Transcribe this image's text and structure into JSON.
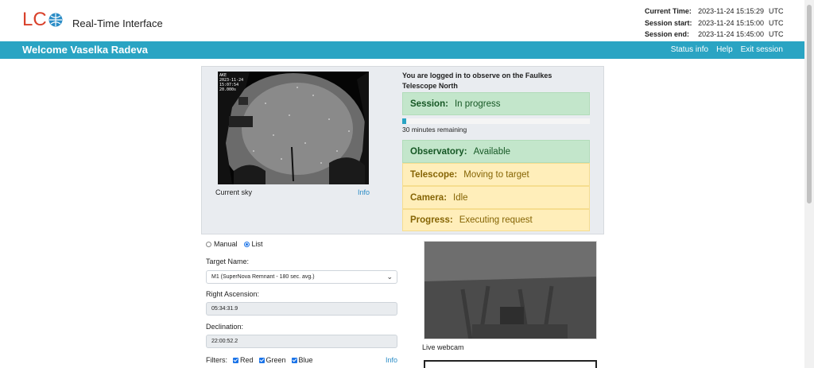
{
  "header": {
    "logo_text": "LC",
    "app_title": "Real-Time Interface",
    "current_time_label": "Current Time:",
    "current_time": "2023-11-24 15:15:29",
    "session_start_label": "Session start:",
    "session_start": "2023-11-24 15:15:00",
    "session_end_label": "Session end:",
    "session_end": "2023-11-24 15:45:00",
    "timezone": "UTC"
  },
  "navbar": {
    "welcome": "Welcome Vaselka Radeva",
    "links": [
      "Status info",
      "Help",
      "Exit session"
    ]
  },
  "sky": {
    "caption": "Current sky",
    "info_link": "Info",
    "stamp_lines": [
      "AKE",
      "2023-11-24",
      "15:07:54",
      "20.000s"
    ]
  },
  "status": {
    "logged_in_text": "You are logged in to observe on the Faulkes Telescope North",
    "session_label": "Session:",
    "session_value": "In progress",
    "progress_fraction": 0.02,
    "remaining": "30 minutes remaining",
    "observatory_label": "Observatory:",
    "observatory_value": "Available",
    "telescope_label": "Telescope:",
    "telescope_value": "Moving to target",
    "camera_label": "Camera:",
    "camera_value": "Idle",
    "progress_label": "Progress:",
    "progress_value": "Executing request"
  },
  "form": {
    "mode_manual": "Manual",
    "mode_list": "List",
    "selected_mode": "List",
    "target_name_label": "Target Name:",
    "target_name_value": "M1 (SuperNova Remnant - 180 sec. avg.)",
    "ra_label": "Right Ascension:",
    "ra_value": "05:34:31.9",
    "dec_label": "Declination:",
    "dec_value": "22:00:52.2",
    "filters_label": "Filters:",
    "filter_red": "Red",
    "filter_green": "Green",
    "filter_blue": "Blue",
    "filters_info": "Info"
  },
  "webcam": {
    "caption": "Live webcam"
  },
  "colors": {
    "navbar": "#2aa4c3",
    "logo": "#d9412b",
    "status_green": "#c3e6cb",
    "status_yellow": "#ffeeba",
    "link": "#2a8cc6"
  }
}
